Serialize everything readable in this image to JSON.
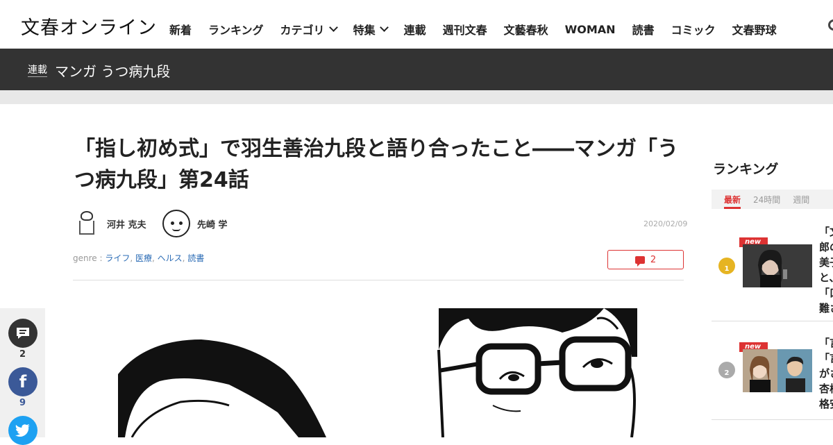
{
  "header": {
    "logo": "文春オンライン",
    "nav": [
      {
        "label": "新着"
      },
      {
        "label": "ランキング"
      },
      {
        "label": "カテゴリ"
      },
      {
        "label": "特集"
      },
      {
        "label": "連載"
      },
      {
        "label": "週刊文春"
      },
      {
        "label": "文藝春秋"
      },
      {
        "label": "WOMAN"
      },
      {
        "label": "読書"
      },
      {
        "label": "コミック"
      },
      {
        "label": "文春野球"
      }
    ]
  },
  "series": {
    "tag": "連載",
    "title": "マンガ うつ病九段"
  },
  "article": {
    "title": "「指し初め式」で羽生善治九段と語り合ったこと――マンガ「うつ病九段」第24話",
    "authors": [
      {
        "name": "河井 克夫"
      },
      {
        "name": "先崎 学"
      }
    ],
    "date": "2020/02/09",
    "genre_label": "genre :",
    "genres": [
      "ライフ",
      "医療",
      "ヘルス",
      "読書"
    ],
    "comment_count": "2"
  },
  "share": {
    "comments": "2",
    "facebook": "9"
  },
  "ranking": {
    "title": "ランキング",
    "tabs": [
      "最新",
      "24時間",
      "週間"
    ],
    "items": [
      {
        "rank": "1",
        "badge": "new",
        "text": "「文\n郎の\n美子\nと、\n「口\n難さ"
      },
      {
        "rank": "2",
        "badge": "new",
        "text": "「言\n「言\nがさ\n杏様\n格安"
      }
    ]
  },
  "colors": {
    "accent": "#dd3333",
    "series_bar": "#333333",
    "facebook": "#3b5998",
    "twitter": "#1da1f2"
  }
}
